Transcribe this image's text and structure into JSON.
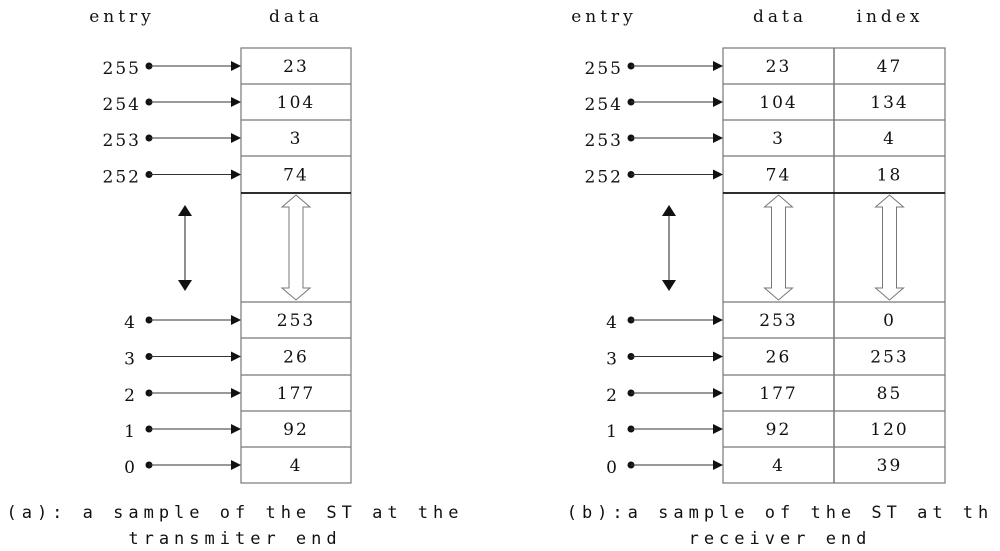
{
  "panels": [
    {
      "id": "a",
      "headers": {
        "entry": "entry",
        "data": "data"
      },
      "top_rows": [
        {
          "entry": "255",
          "data": "23"
        },
        {
          "entry": "254",
          "data": "104"
        },
        {
          "entry": "253",
          "data": "3"
        },
        {
          "entry": "252",
          "data": "74"
        }
      ],
      "bottom_rows": [
        {
          "entry": "4",
          "data": "253"
        },
        {
          "entry": "3",
          "data": "26"
        },
        {
          "entry": "2",
          "data": "177"
        },
        {
          "entry": "1",
          "data": "92"
        },
        {
          "entry": "0",
          "data": "4"
        }
      ],
      "caption_line1": "(a): a sample of the ST at the",
      "caption_line2": "transmiter end"
    },
    {
      "id": "b",
      "headers": {
        "entry": "entry",
        "data": "data",
        "index": "index"
      },
      "top_rows": [
        {
          "entry": "255",
          "data": "23",
          "index": "47"
        },
        {
          "entry": "254",
          "data": "104",
          "index": "134"
        },
        {
          "entry": "253",
          "data": "3",
          "index": "4"
        },
        {
          "entry": "252",
          "data": "74",
          "index": "18"
        }
      ],
      "bottom_rows": [
        {
          "entry": "4",
          "data": "253",
          "index": "0"
        },
        {
          "entry": "3",
          "data": "26",
          "index": "253"
        },
        {
          "entry": "2",
          "data": "177",
          "index": "85"
        },
        {
          "entry": "1",
          "data": "92",
          "index": "120"
        },
        {
          "entry": "0",
          "data": "4",
          "index": "39"
        }
      ],
      "caption_line1": "(b):a sample of the ST at th",
      "caption_line2": "receiver end"
    }
  ],
  "colors": {
    "ink": "#111111",
    "grid": "#777777"
  }
}
